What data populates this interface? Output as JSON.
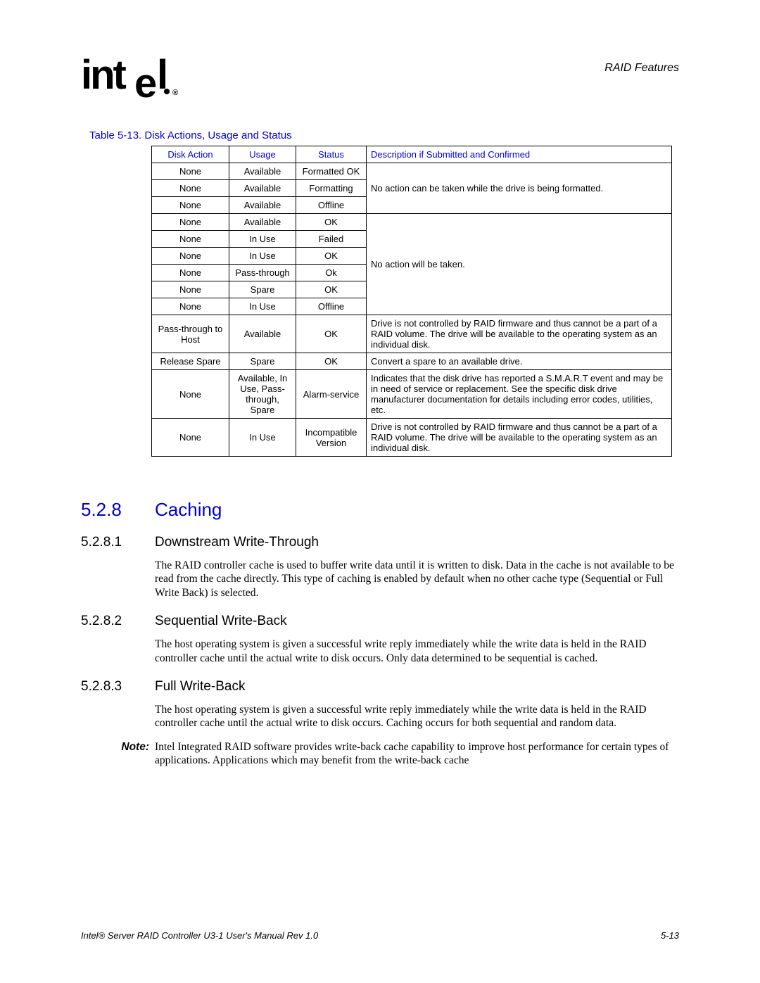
{
  "header": {
    "chapter": "RAID Features"
  },
  "tableCaption": "Table 5-13. Disk Actions, Usage and Status",
  "tableHeaders": {
    "c0": "Disk Action",
    "c1": "Usage",
    "c2": "Status",
    "c3": "Description if Submitted and Confirmed"
  },
  "rows": {
    "r0": {
      "a": "None",
      "u": "Available",
      "s": "Formatted OK"
    },
    "r1": {
      "a": "None",
      "u": "Available",
      "s": "Formatting",
      "d": "No action can be taken while the drive is being formatted."
    },
    "r2": {
      "a": "None",
      "u": "Available",
      "s": "Offline"
    },
    "r3": {
      "a": "None",
      "u": "Available",
      "s": "OK"
    },
    "r4": {
      "a": "None",
      "u": "In Use",
      "s": "Failed"
    },
    "r5": {
      "a": "None",
      "u": "In Use",
      "s": "OK"
    },
    "r6": {
      "a": "None",
      "u": "Pass-through",
      "s": "Ok",
      "d": "No action will be taken."
    },
    "r7": {
      "a": "None",
      "u": "Spare",
      "s": "OK"
    },
    "r8": {
      "a": "None",
      "u": "In Use",
      "s": "Offline"
    },
    "r9": {
      "a": "Pass-through to Host",
      "u": "Available",
      "s": "OK",
      "d": "Drive is not controlled by RAID firmware and thus cannot be a part of a RAID volume. The drive will be available to the operating system as an individual disk."
    },
    "r10": {
      "a": "Release Spare",
      "u": "Spare",
      "s": "OK",
      "d": "Convert a spare to an available drive."
    },
    "r11": {
      "a": "None",
      "u": "Available, In Use, Pass-through, Spare",
      "s": "Alarm-service",
      "d": "Indicates that the disk drive has reported a S.M.A.R.T event and may be in need of service or replacement.  See the specific disk drive manufacturer documentation for details including error codes, utilities, etc."
    },
    "r12": {
      "a": "None",
      "u": "In Use",
      "s": "Incompatible Version",
      "d": "Drive is not controlled by RAID firmware and thus cannot be a part of a RAID volume. The drive will be available to the operating system as an individual disk."
    }
  },
  "sections": {
    "s528": {
      "num": "5.2.8",
      "title": "Caching"
    },
    "s5281": {
      "num": "5.2.8.1",
      "title": "Downstream Write-Through",
      "body": "The RAID controller cache is used to buffer write data until it is written to disk. Data in the cache is not available to be read from the cache directly. This type of caching is enabled by default when no other cache type (Sequential or Full Write Back) is selected."
    },
    "s5282": {
      "num": "5.2.8.2",
      "title": "Sequential Write-Back",
      "body": "The host operating system is given a successful write reply immediately while the write data is held in the RAID controller cache until the actual write to disk occurs. Only data determined to be sequential is cached."
    },
    "s5283": {
      "num": "5.2.8.3",
      "title": "Full Write-Back",
      "body": "The host operating system is given a successful write reply immediately while the write data is held in the RAID controller cache until the actual write to disk occurs. Caching occurs for both sequential and random data."
    }
  },
  "note": {
    "label": "Note:",
    "body": "Intel Integrated RAID software provides write-back cache capability to improve host performance for certain types of applications. Applications which may benefit from the write-back cache"
  },
  "footer": {
    "left": "Intel® Server RAID Controller U3-1 User's Manual Rev 1.0",
    "right": "5-13"
  }
}
